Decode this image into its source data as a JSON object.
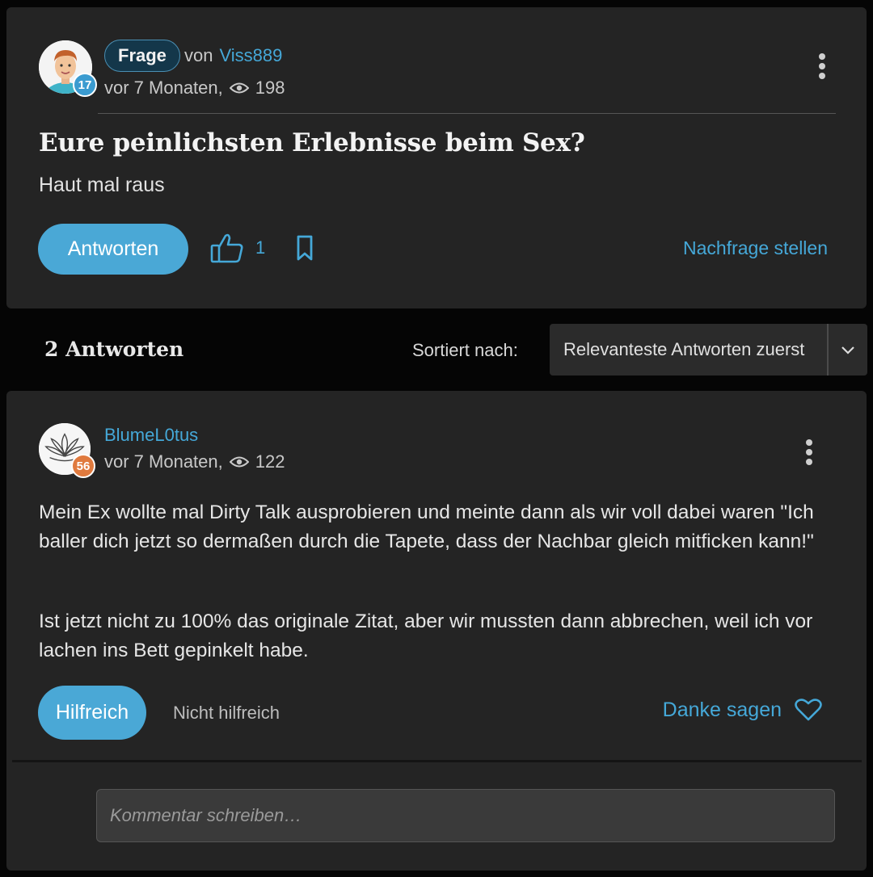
{
  "question": {
    "badge_level": "17",
    "type_label": "Frage",
    "by_label": "von",
    "author": "Viss889",
    "time": "vor 7 Monaten,",
    "views": "198",
    "title": "Eure peinlichsten Erlebnisse beim Sex?",
    "body": "Haut mal raus",
    "answer_button": "Antworten",
    "likes": "1",
    "followup_link": "Nachfrage stellen"
  },
  "answers_header": {
    "count_label": "2 Antworten",
    "sort_label": "Sortiert nach:",
    "sort_value": "Relevanteste Antworten zuerst"
  },
  "answer": {
    "author": "BlumeL0tus",
    "badge_level": "56",
    "time": "vor 7 Monaten,",
    "views": "122",
    "paragraph1": "Mein Ex wollte mal Dirty Talk ausprobieren und meinte dann als wir voll dabei waren \"Ich baller dich jetzt so dermaßen durch die Tapete, dass der Nachbar gleich mitficken kann!\"",
    "paragraph2": "Ist jetzt nicht zu 100% das originale Zitat, aber wir mussten dann abbrechen, weil ich vor lachen ins Bett gepinkelt habe.",
    "helpful_button": "Hilfreich",
    "not_helpful_button": "Nicht hilfreich",
    "thanks_label": "Danke sagen",
    "comment_placeholder": "Kommentar schreiben…"
  },
  "colors": {
    "accent": "#45a8d8",
    "card_bg": "#242424",
    "page_bg": "#050505"
  },
  "icons": [
    "eye-icon",
    "thumbs-up-icon",
    "bookmark-icon",
    "chevron-down-icon",
    "heart-icon",
    "more-vertical-icon"
  ]
}
